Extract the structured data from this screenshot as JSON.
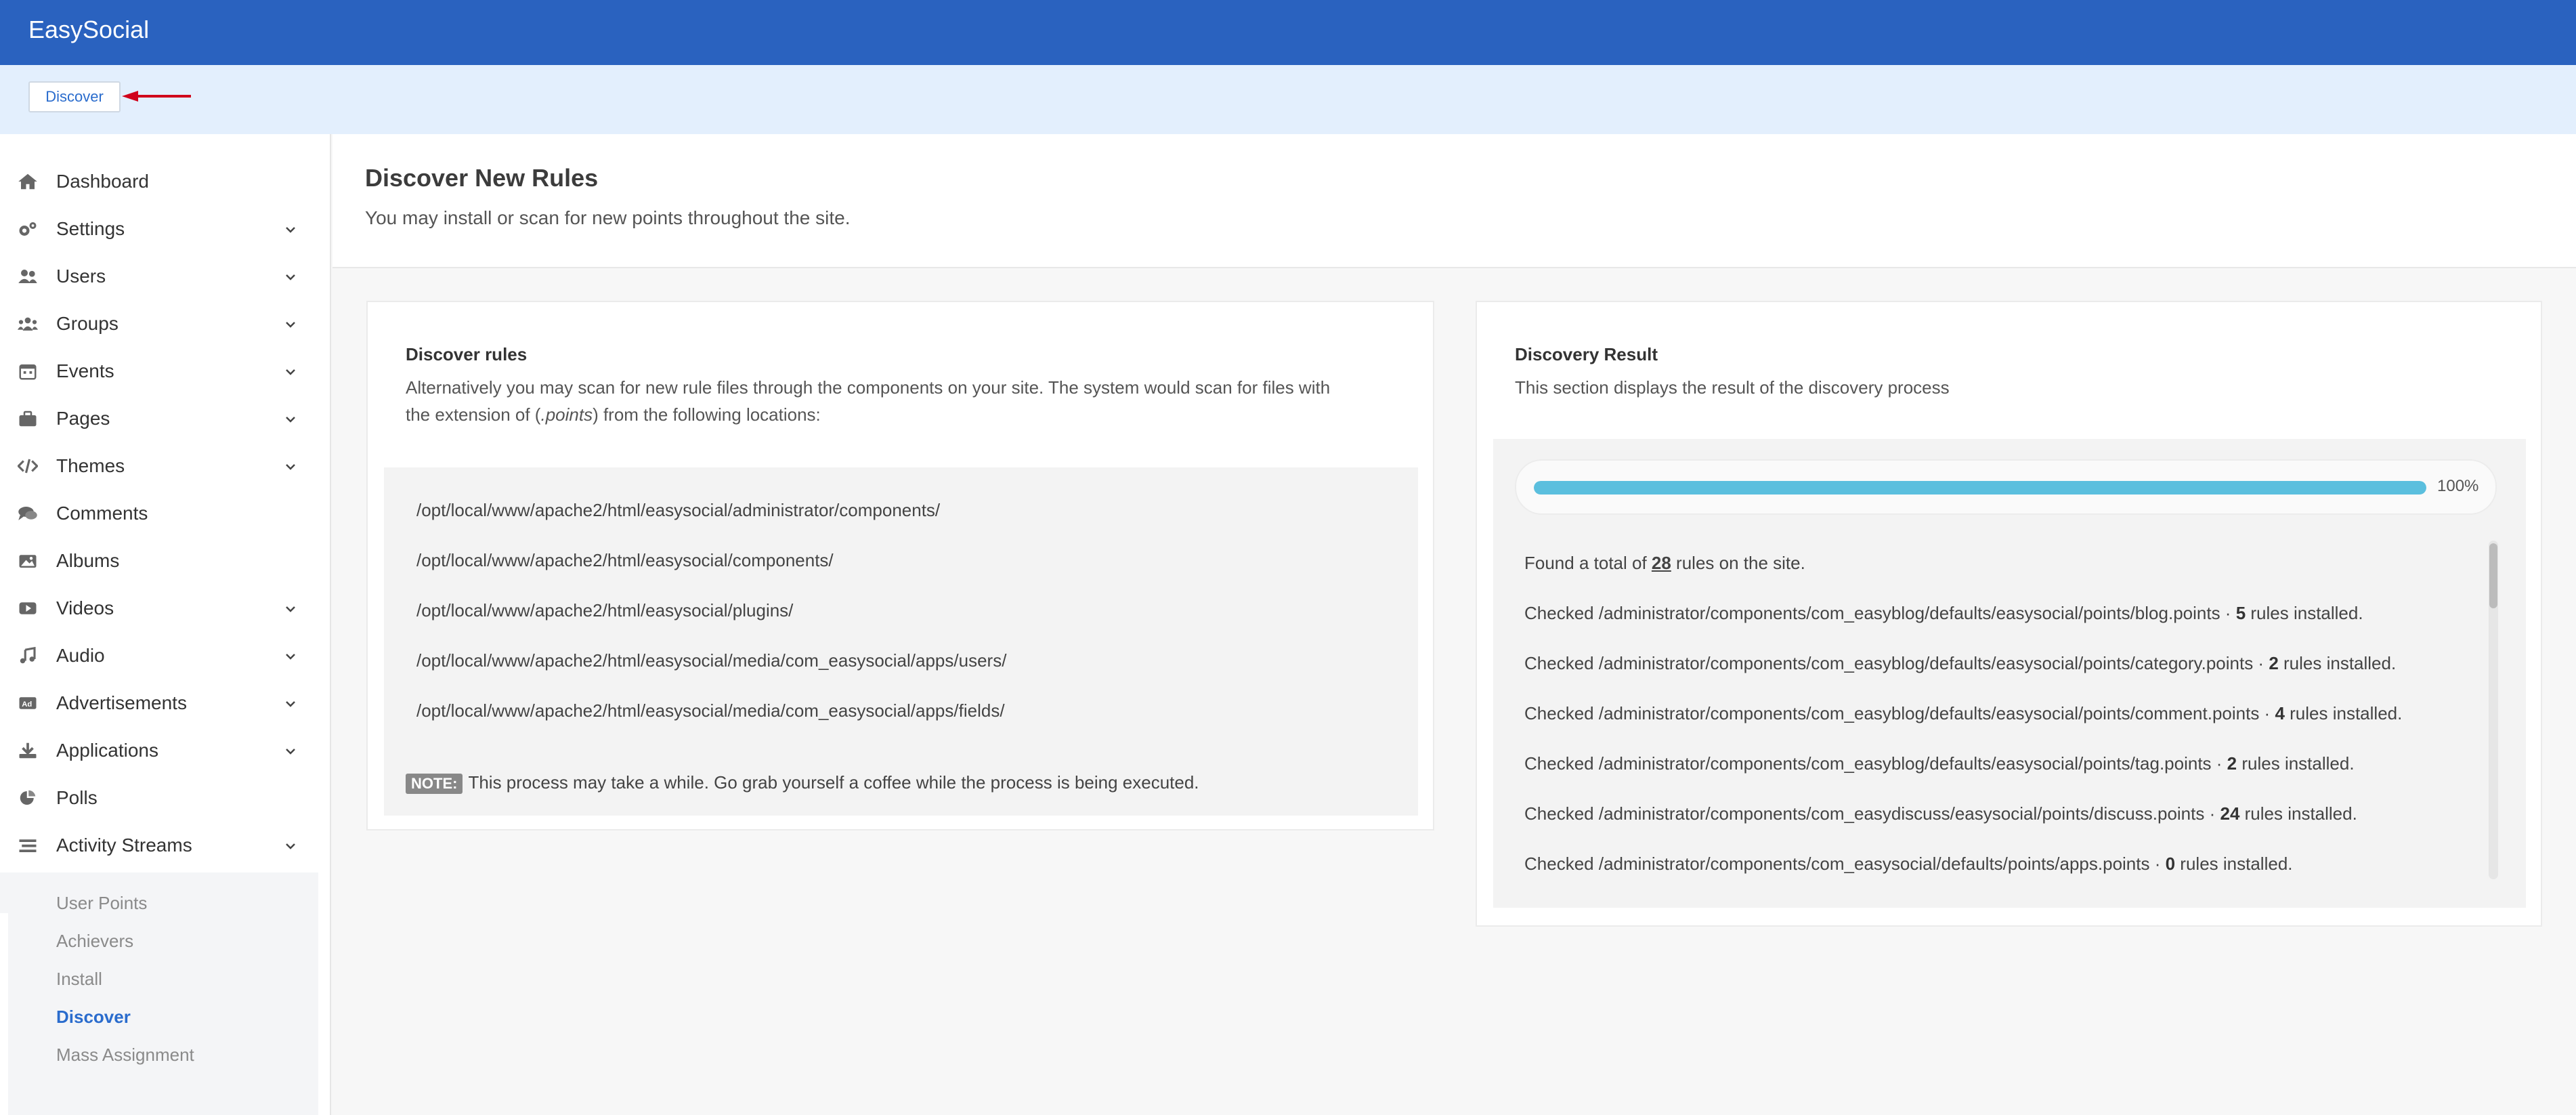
{
  "app": {
    "title": "EasySocial"
  },
  "subbar": {
    "discover_label": "Discover"
  },
  "sidebar": {
    "items": [
      {
        "label": "Dashboard",
        "icon": "home-icon",
        "expandable": false
      },
      {
        "label": "Settings",
        "icon": "cogs-icon",
        "expandable": true
      },
      {
        "label": "Users",
        "icon": "users-icon",
        "expandable": true
      },
      {
        "label": "Groups",
        "icon": "groups-icon",
        "expandable": true
      },
      {
        "label": "Events",
        "icon": "calendar-icon",
        "expandable": true
      },
      {
        "label": "Pages",
        "icon": "briefcase-icon",
        "expandable": true
      },
      {
        "label": "Themes",
        "icon": "code-icon",
        "expandable": true
      },
      {
        "label": "Comments",
        "icon": "comments-icon",
        "expandable": false
      },
      {
        "label": "Albums",
        "icon": "image-icon",
        "expandable": false
      },
      {
        "label": "Videos",
        "icon": "video-icon",
        "expandable": true
      },
      {
        "label": "Audio",
        "icon": "music-icon",
        "expandable": true
      },
      {
        "label": "Advertisements",
        "icon": "ad-icon",
        "expandable": true
      },
      {
        "label": "Applications",
        "icon": "download-icon",
        "expandable": true
      },
      {
        "label": "Polls",
        "icon": "pie-chart-icon",
        "expandable": false
      },
      {
        "label": "Activity Streams",
        "icon": "stream-icon",
        "expandable": true
      },
      {
        "label": "User Points",
        "icon": "award-icon",
        "expandable": true,
        "expanded": true,
        "active": true
      }
    ],
    "subitems": [
      {
        "label": "User Points",
        "active": false
      },
      {
        "label": "Achievers",
        "active": false
      },
      {
        "label": "Install",
        "active": false
      },
      {
        "label": "Discover",
        "active": true
      },
      {
        "label": "Mass Assignment",
        "active": false
      }
    ]
  },
  "header": {
    "title": "Discover New Rules",
    "description": "You may install or scan for new points throughout the site."
  },
  "discover_card": {
    "title": "Discover rules",
    "text_line1": "Alternatively you may scan for new rule files through the components on your site. The system would scan for files with",
    "text_line2_pre": "the extension of (",
    "text_line2_em": ".points",
    "text_line2_post": ") from the following locations:",
    "paths": [
      "/opt/local/www/apache2/html/easysocial/administrator/components/",
      "/opt/local/www/apache2/html/easysocial/components/",
      "/opt/local/www/apache2/html/easysocial/plugins/",
      "/opt/local/www/apache2/html/easysocial/media/com_easysocial/apps/users/",
      "/opt/local/www/apache2/html/easysocial/media/com_easysocial/apps/fields/"
    ],
    "note_badge": "NOTE:",
    "note_text": "This process may take a while. Go grab yourself a coffee while the process is being executed."
  },
  "result_card": {
    "title": "Discovery Result",
    "description": "This section displays the result of the discovery process",
    "progress_percent": 100,
    "progress_label": "100%",
    "total_pre": "Found a total of ",
    "total_count": "28",
    "total_post": " rules on the site.",
    "lines": [
      {
        "prefix": "Checked /administrator/components/com_easyblog/defaults/easysocial/points/blog.points · ",
        "count": "5",
        "suffix": " rules installed."
      },
      {
        "prefix": "Checked /administrator/components/com_easyblog/defaults/easysocial/points/category.points · ",
        "count": "2",
        "suffix": " rules installed."
      },
      {
        "prefix": "Checked /administrator/components/com_easyblog/defaults/easysocial/points/comment.points · ",
        "count": "4",
        "suffix": " rules installed."
      },
      {
        "prefix": "Checked /administrator/components/com_easyblog/defaults/easysocial/points/tag.points · ",
        "count": "2",
        "suffix": " rules installed."
      },
      {
        "prefix": "Checked /administrator/components/com_easydiscuss/easysocial/points/discuss.points · ",
        "count": "24",
        "suffix": " rules installed."
      },
      {
        "prefix": "Checked /administrator/components/com_easysocial/defaults/points/apps.points · ",
        "count": "0",
        "suffix": " rules installed."
      }
    ]
  },
  "colors": {
    "brand": "#2a62bf",
    "accent": "#2a6ccd",
    "progress": "#5bbfde",
    "annotation_arrow": "#d0021b"
  }
}
